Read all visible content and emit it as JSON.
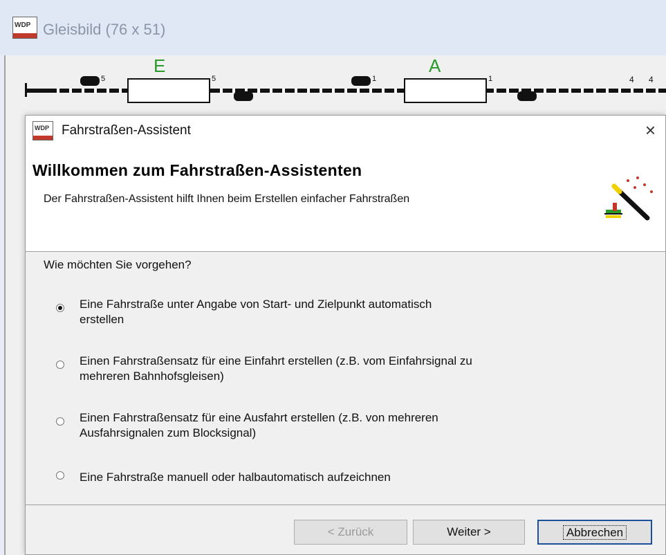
{
  "background_window": {
    "title": "Gleisbild (76 x 51)",
    "icon_text": "WDP",
    "track_labels": [
      "E",
      "A"
    ],
    "signal_numbers": [
      "5",
      "5",
      "1",
      "1",
      "4",
      "4"
    ]
  },
  "dialog": {
    "title": "Fahrstraßen-Assistent",
    "close_symbol": "×",
    "header": {
      "title": "Willkommen zum Fahrstraßen-Assistenten",
      "subtitle": "Der Fahrstraßen-Assistent hilft Ihnen beim Erstellen einfacher Fahrstraßen"
    },
    "question": "Wie möchten Sie vorgehen?",
    "options": [
      {
        "line1": "Eine Fahrstraße unter Angabe von Start- und Zielpunkt automatisch",
        "line2": "erstellen",
        "selected": true
      },
      {
        "line1": "Einen Fahrstraßensatz für eine Einfahrt erstellen (z.B. vom Einfahrsignal zu",
        "line2": "mehreren Bahnhofsgleisen)",
        "selected": false
      },
      {
        "line1": "Einen Fahrstraßensatz für eine Ausfahrt erstellen (z.B. von mehreren",
        "line2": "Ausfahrsignalen zum Blocksignal)",
        "selected": false
      },
      {
        "line1": "Eine Fahrstraße manuell oder halbautomatisch aufzeichnen",
        "line2": "",
        "selected": false
      }
    ],
    "buttons": {
      "back": "< Zurück",
      "next": "Weiter >",
      "cancel": "Abbrechen"
    }
  },
  "colors": {
    "track_label": "#2a9a2a",
    "focus_border": "#1c4f9c"
  }
}
